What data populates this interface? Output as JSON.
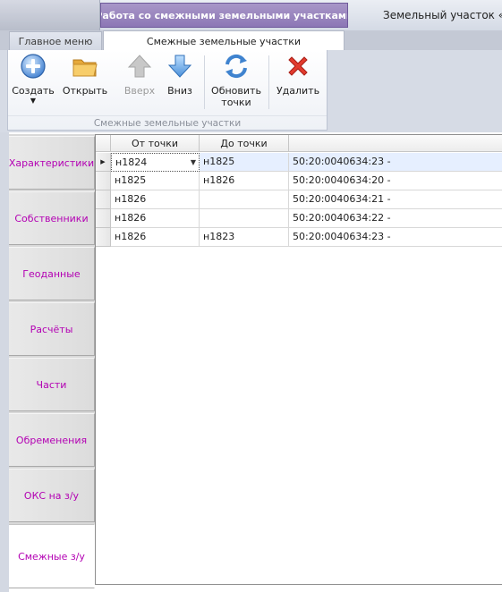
{
  "window": {
    "context_tab": "Работа со смежными земельными участками",
    "title": "Земельный участок «:ЗУ"
  },
  "tabs": {
    "main_menu": "Главное меню",
    "adjacent": "Смежные земельные участки"
  },
  "ribbon": {
    "buttons": [
      {
        "id": "create",
        "label": "Создать",
        "icon": "add-icon",
        "enabled": true,
        "has_dropdown": true
      },
      {
        "id": "open",
        "label": "Открыть",
        "icon": "folder-icon",
        "enabled": true
      },
      {
        "id": "up",
        "label": "Вверх",
        "icon": "arrow-up-icon",
        "enabled": false
      },
      {
        "id": "down",
        "label": "Вниз",
        "icon": "arrow-down-icon",
        "enabled": true
      },
      {
        "id": "refresh",
        "label_line1": "Обновить",
        "label_line2": "точки",
        "icon": "refresh-icon",
        "enabled": true
      },
      {
        "id": "delete",
        "label": "Удалить",
        "icon": "delete-icon",
        "enabled": true
      }
    ],
    "group_label": "Смежные земельные участки"
  },
  "side_tabs": [
    {
      "label": "Характеристики",
      "active": false
    },
    {
      "label": "Собственники",
      "active": false
    },
    {
      "label": "Геоданные",
      "active": false
    },
    {
      "label": "Расчёты",
      "active": false
    },
    {
      "label": "Части",
      "active": false
    },
    {
      "label": "Обременения",
      "active": false
    },
    {
      "label": "ОКС на з/у",
      "active": false
    },
    {
      "label": "Смежные з/у",
      "active": true
    }
  ],
  "grid": {
    "columns": [
      "От точки",
      "До точки",
      ""
    ],
    "rows": [
      {
        "from": "н1824",
        "to": "н1825",
        "parcel": "50:20:0040634:23 -",
        "selected": true
      },
      {
        "from": "н1825",
        "to": "н1826",
        "parcel": "50:20:0040634:20 -"
      },
      {
        "from": "н1826",
        "to": "",
        "parcel": "50:20:0040634:21 -"
      },
      {
        "from": "н1826",
        "to": "",
        "parcel": "50:20:0040634:22 -"
      },
      {
        "from": "н1826",
        "to": "н1823",
        "parcel": "50:20:0040634:23 -"
      }
    ]
  },
  "colors": {
    "context_tab": "#9d8bc2",
    "side_tab_text": "#b300b3",
    "selected_row": "#e6efff"
  }
}
